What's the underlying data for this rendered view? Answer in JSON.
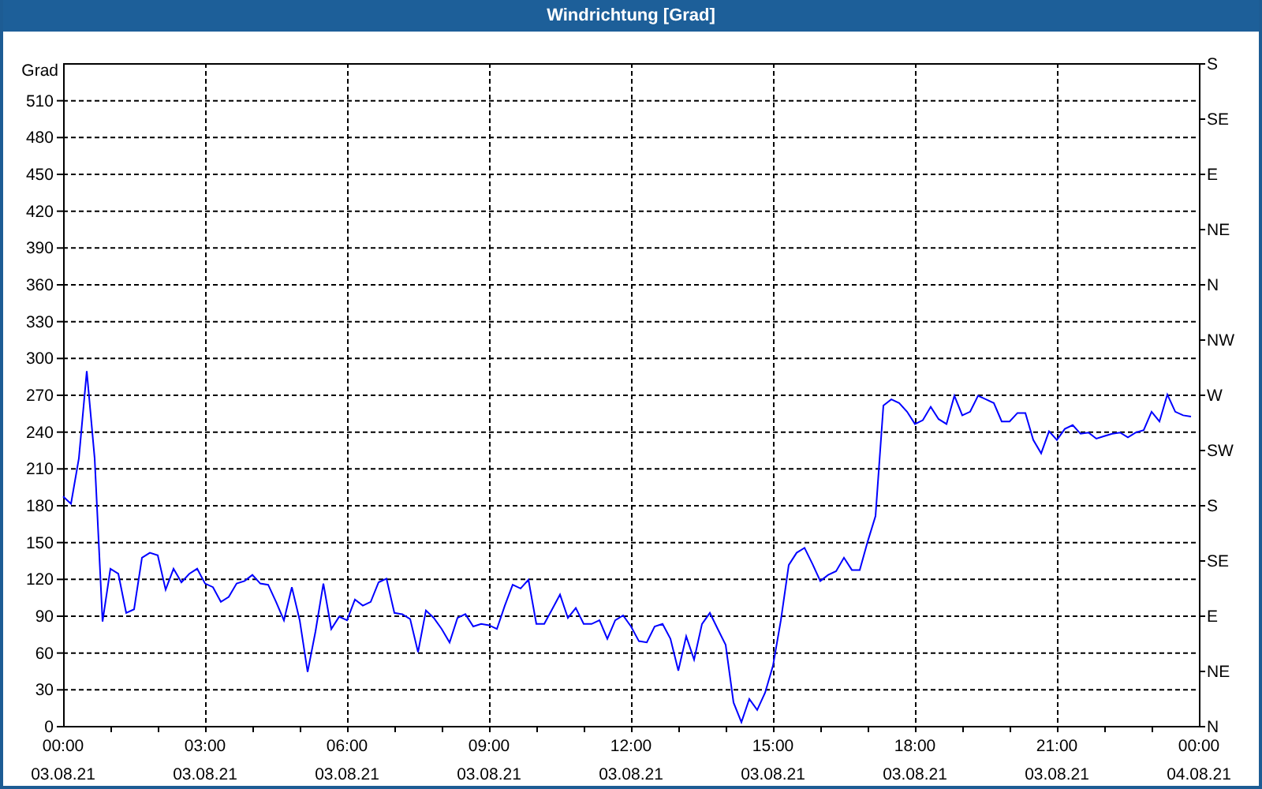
{
  "window": {
    "title": "Windrichtung [Grad]"
  },
  "right_axis": {
    "labels": [
      "S",
      "SE",
      "E",
      "NE",
      "N",
      "NW",
      "W",
      "SW",
      "S",
      "SE",
      "E",
      "NE",
      "N"
    ]
  },
  "x_axis": {
    "dates": [
      "03.08.21",
      "03.08.21",
      "03.08.21",
      "03.08.21",
      "03.08.21",
      "03.08.21",
      "03.08.21",
      "03.08.21",
      "04.08.21"
    ]
  },
  "chart_data": {
    "type": "line",
    "grid": true,
    "ylabel": "Grad",
    "xlim": [
      0,
      24
    ],
    "ylim": [
      0,
      540
    ],
    "xticks": [
      {
        "value": 0,
        "label": "00:00"
      },
      {
        "value": 3,
        "label": "03:00"
      },
      {
        "value": 6,
        "label": "06:00"
      },
      {
        "value": 9,
        "label": "09:00"
      },
      {
        "value": 12,
        "label": "12:00"
      },
      {
        "value": 15,
        "label": "15:00"
      },
      {
        "value": 18,
        "label": "18:00"
      },
      {
        "value": 21,
        "label": "21:00"
      },
      {
        "value": 24,
        "label": "00:00"
      }
    ],
    "yticks": [
      0,
      30,
      60,
      90,
      120,
      150,
      180,
      210,
      240,
      270,
      300,
      330,
      360,
      390,
      420,
      450,
      480,
      510
    ],
    "x": [
      0,
      0.167,
      0.333,
      0.5,
      0.667,
      0.833,
      1,
      1.167,
      1.333,
      1.5,
      1.667,
      1.833,
      2,
      2.167,
      2.333,
      2.5,
      2.667,
      2.833,
      3,
      3.167,
      3.333,
      3.5,
      3.667,
      3.833,
      4,
      4.167,
      4.333,
      4.5,
      4.667,
      4.833,
      5,
      5.167,
      5.333,
      5.5,
      5.667,
      5.833,
      6,
      6.167,
      6.333,
      6.5,
      6.667,
      6.833,
      7,
      7.167,
      7.333,
      7.5,
      7.667,
      7.833,
      8,
      8.167,
      8.333,
      8.5,
      8.667,
      8.833,
      9,
      9.167,
      9.333,
      9.5,
      9.667,
      9.833,
      10,
      10.167,
      10.333,
      10.5,
      10.667,
      10.833,
      11,
      11.167,
      11.333,
      11.5,
      11.667,
      11.833,
      12,
      12.167,
      12.333,
      12.5,
      12.667,
      12.833,
      13,
      13.167,
      13.333,
      13.5,
      13.667,
      13.833,
      14,
      14.167,
      14.333,
      14.5,
      14.667,
      14.833,
      15,
      15.167,
      15.333,
      15.5,
      15.667,
      15.833,
      16,
      16.167,
      16.333,
      16.5,
      16.667,
      16.833,
      17,
      17.167,
      17.333,
      17.5,
      17.667,
      17.833,
      18,
      18.167,
      18.333,
      18.5,
      18.667,
      18.833,
      19,
      19.167,
      19.333,
      19.5,
      19.667,
      19.833,
      20,
      20.167,
      20.333,
      20.5,
      20.667,
      20.833,
      21,
      21.167,
      21.333,
      21.5,
      21.667,
      21.833,
      22,
      22.167,
      22.333,
      22.5,
      22.667,
      22.833,
      23,
      23.167,
      23.333,
      23.5,
      23.667,
      23.833
    ],
    "series": [
      {
        "color": "#0000ff",
        "values": [
          187,
          181,
          218,
          289,
          218,
          85,
          128,
          124,
          92,
          95,
          137,
          141,
          139,
          111,
          128,
          117,
          124,
          128,
          116,
          113,
          101,
          105,
          116,
          118,
          123,
          116,
          115,
          101,
          86,
          113,
          86,
          44,
          77,
          116,
          79,
          89,
          86,
          103,
          98,
          101,
          117,
          120,
          92,
          91,
          87,
          60,
          94,
          88,
          79,
          68,
          88,
          91,
          81,
          83,
          82,
          79,
          98,
          115,
          112,
          119,
          83,
          83,
          95,
          107,
          88,
          96,
          83,
          83,
          86,
          71,
          86,
          90,
          81,
          69,
          68,
          81,
          83,
          71,
          45,
          73,
          54,
          83,
          92,
          79,
          66,
          19,
          3,
          22,
          13,
          27,
          49,
          86,
          131,
          141,
          145,
          132,
          118,
          123,
          126,
          137,
          127,
          127,
          150,
          171,
          261,
          266,
          263,
          256,
          246,
          249,
          260,
          250,
          246,
          269,
          253,
          256,
          269,
          266,
          263,
          248,
          248,
          255,
          255,
          233,
          222,
          240,
          233,
          242,
          245,
          238,
          239,
          234,
          236,
          238,
          239,
          235,
          239,
          241,
          256,
          248,
          270,
          256,
          253,
          252
        ]
      }
    ]
  }
}
